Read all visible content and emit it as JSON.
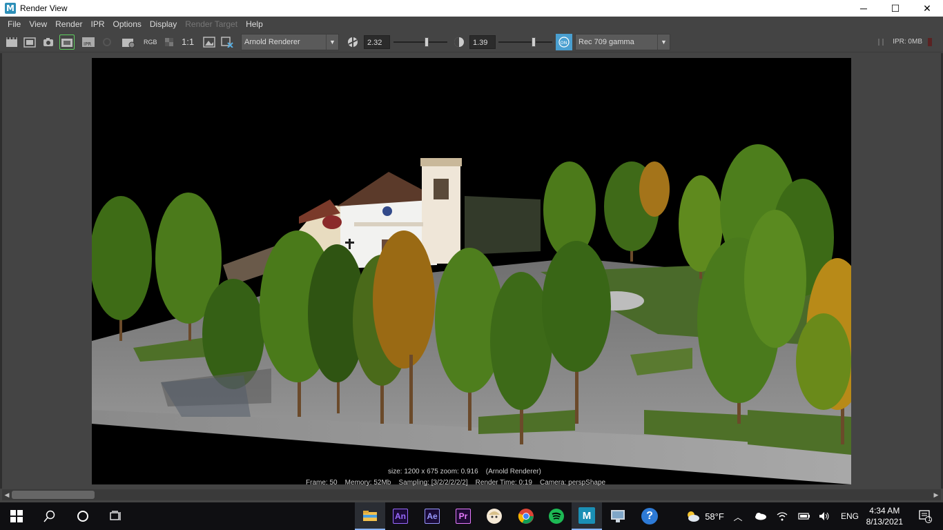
{
  "window": {
    "title": "Render View",
    "app_letter": "M"
  },
  "window_controls": {
    "minimize": "─",
    "maximize": "☐",
    "close": "✕"
  },
  "menu": [
    "File",
    "View",
    "Render",
    "IPR",
    "Options",
    "Display",
    "Render Target",
    "Help"
  ],
  "menu_disabled": [
    "Render Target"
  ],
  "toolbar": {
    "rgb_label": "RGB",
    "ratio_label": "1:1",
    "renderer": "Arnold Renderer",
    "exposure": "2.32",
    "exposure_level": 0.62,
    "gamma": "1.39",
    "gamma_level": 0.66,
    "color_mgmt_badge": "ON",
    "view_transform": "Rec 709 gamma",
    "ipr_memory": "IPR: 0MB"
  },
  "render_info": {
    "line1": "size: 1200 x 675 zoom: 0.916    (Arnold Renderer)",
    "line2": "Frame: 50    Memory: 52Mb    Sampling: [3/2/2/2/2/2]    Render Time: 0:19    Camera: perspShape"
  },
  "taskbar": {
    "apps": [
      {
        "name": "file-explorer",
        "label": ""
      },
      {
        "name": "animate",
        "label": "An",
        "color": "#9a6bff"
      },
      {
        "name": "after-effects",
        "label": "Ae",
        "color": "#9999ff"
      },
      {
        "name": "premiere",
        "label": "Pr",
        "color": "#e77bff"
      },
      {
        "name": "game-character",
        "label": ""
      },
      {
        "name": "chrome",
        "label": ""
      },
      {
        "name": "spotify",
        "label": ""
      },
      {
        "name": "maya",
        "label": "M"
      },
      {
        "name": "remote-desktop",
        "label": ""
      },
      {
        "name": "help",
        "label": "?"
      }
    ],
    "temperature": "58°F",
    "language": "ENG",
    "time": "4:34 AM",
    "date": "8/13/2021",
    "notification_count": "1"
  },
  "colors": {
    "maya_bg": "#444444",
    "accent_on": "#4a9fd0",
    "taskbar_bg": "#0f0f12"
  }
}
